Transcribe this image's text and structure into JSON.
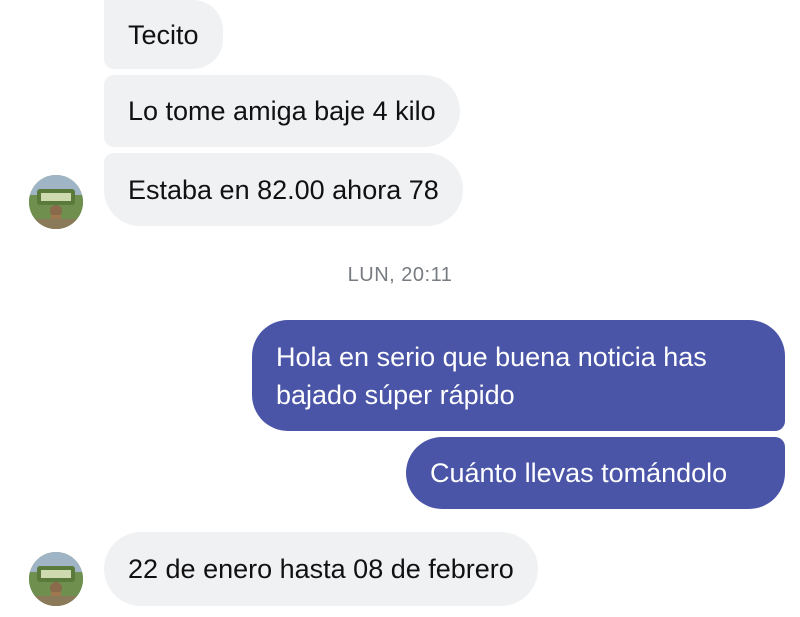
{
  "messages": {
    "m1": "Tecito",
    "m2": "Lo tome amiga  baje 4 kilo",
    "m3": "Estaba en 82.00 ahora 78",
    "m4": "Hola en serio que buena noticia has bajado súper rápido",
    "m4_line1": "Hola en serio que buena noticia has",
    "m4_line2": "bajado súper rápido",
    "m5": "Cuánto llevas tomándolo",
    "m6": "22 de enero hasta 08 de febrero"
  },
  "timestamp": "LUN, 20:11",
  "colors": {
    "incoming_bubble": "#f0f1f3",
    "outgoing_bubble": "#4a55a8",
    "timestamp_text": "#777b82"
  },
  "icons": {
    "avatar": "contact-avatar-photo"
  }
}
